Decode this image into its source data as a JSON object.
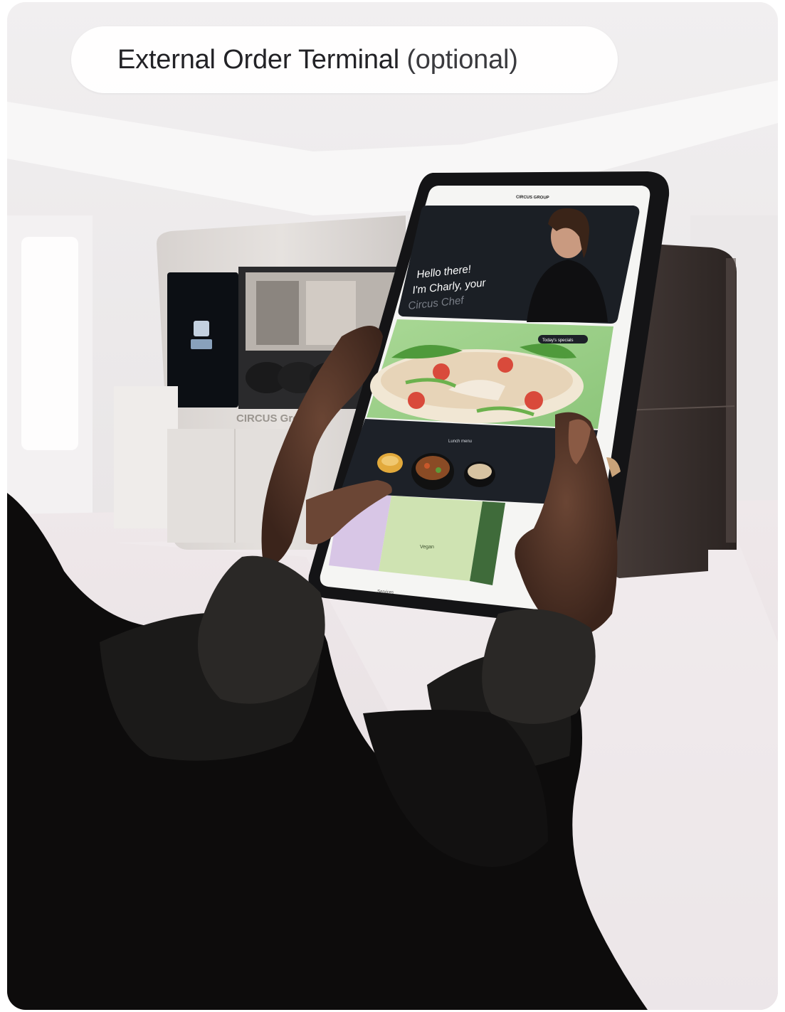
{
  "header": {
    "title": "External Order Terminal",
    "subtitle": "(optional)"
  },
  "tablet_screen": {
    "brand": "CIRCUS GROUP",
    "hero_text": [
      "Hello there!",
      "I'm Charly, your",
      "Circus Chef"
    ],
    "badge": "Today's specials",
    "section_label": "Lunch menu",
    "tile_label": "Vegan",
    "footer_label": "Services"
  },
  "machine": {
    "brand_label": "CIRCUS Group"
  },
  "colors": {
    "page_bg": "#ffffff",
    "pill_bg": "#ffffff",
    "title_text": "#222226",
    "tablet_frame": "#141416",
    "screen_dark": "#1d2128",
    "salad_green": "#9fd08c"
  }
}
